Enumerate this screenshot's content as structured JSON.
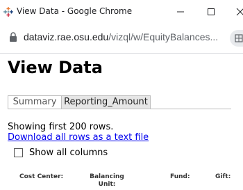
{
  "window": {
    "title": "View Data - Google Chrome",
    "minimize_icon": "minimize-icon",
    "maximize_icon": "maximize-icon",
    "close_icon": "close-icon"
  },
  "address_bar": {
    "host": "dataviz.rae.osu.edu",
    "path": "/vizql/w/EquityBalances...",
    "lock_icon": "lock-icon",
    "extension_icon": "extension-icon"
  },
  "page": {
    "title": "View Data",
    "tabs": [
      {
        "label": "Summary",
        "selected": false
      },
      {
        "label": "Reporting_Amount",
        "selected": true
      }
    ],
    "rows_info": "Showing first 200 rows.",
    "download_link": "Download all rows as a text file",
    "show_all_columns": {
      "label": "Show all columns",
      "checked": false
    },
    "columns": [
      "Cost Center:",
      "Balancing Unit:",
      "Fund:",
      "Gift:"
    ]
  },
  "colors": {
    "link": "#0000ee",
    "selected_tab": "#e6e6e6",
    "border": "#bdbdbd"
  }
}
